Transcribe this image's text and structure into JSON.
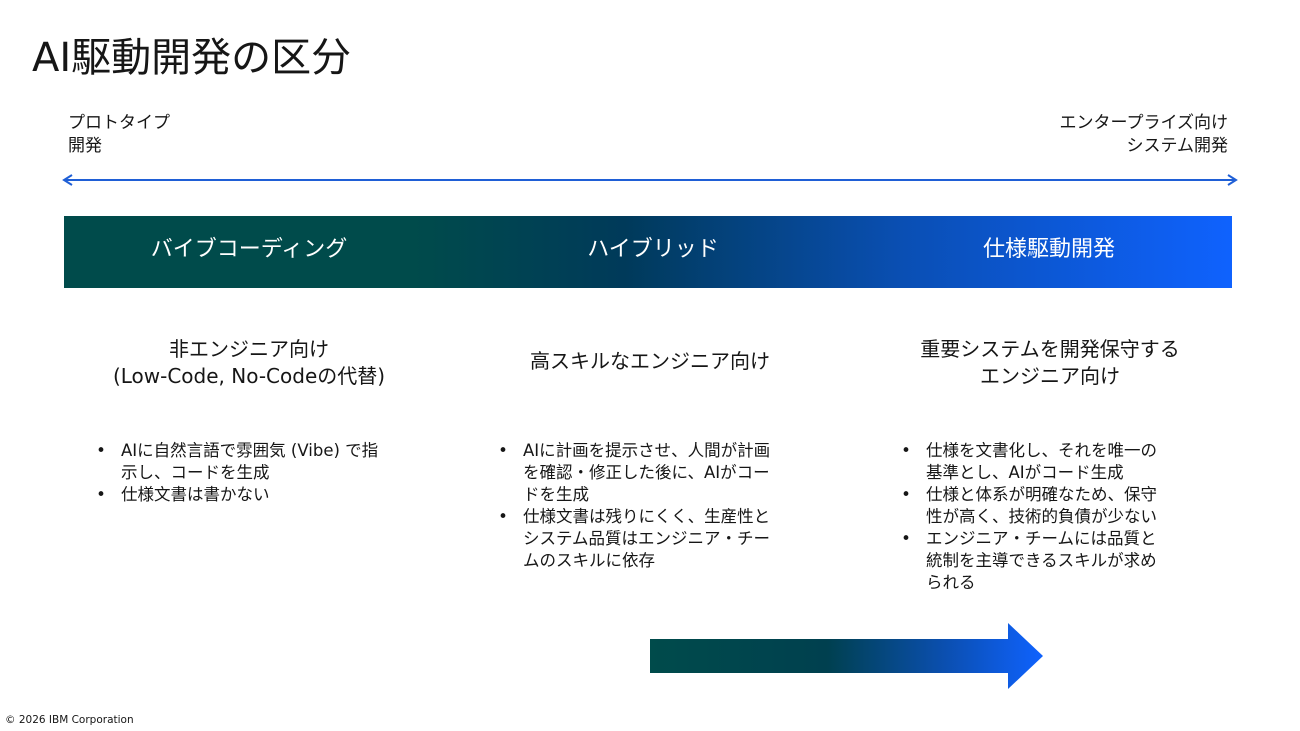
{
  "slide": {
    "title": "AI駆動開発の区分"
  },
  "spectrum": {
    "left_line1": "プロトタイプ",
    "left_line2": "開発",
    "right_line1": "エンタープライズ向け",
    "right_line2": "システム開発",
    "arrow_color": "#1f5fd6"
  },
  "columns": [
    {
      "label": "バイブコーディング",
      "audience": [
        "非エンジニア向け",
        "(Low-Code, No-Codeの代替)"
      ],
      "bullets": [
        [
          "AIに自然言語で雰囲気 (Vibe) で指",
          "示し、コードを生成"
        ],
        [
          "仕様文書は書かない"
        ]
      ]
    },
    {
      "label": "ハイブリッド",
      "audience": [
        "高スキルなエンジニア向け"
      ],
      "bullets": [
        [
          "AIに計画を提示させ、人間が計画",
          "を確認・修正した後に、AIがコー",
          "ドを生成"
        ],
        [
          "仕様文書は残りにくく、生産性と",
          "システム品質はエンジニア・チー",
          "ムのスキルに依存"
        ]
      ]
    },
    {
      "label": "仕様駆動開発",
      "audience": [
        "重要システムを開発保守する",
        "エンジニア向け"
      ],
      "bullets": [
        [
          "仕様を文書化し、それを唯一の",
          "基準とし、AIがコード生成"
        ],
        [
          "仕様と体系が明確なため、保守",
          "性が高く、技術的負債が少ない"
        ],
        [
          "エンジニア・チームには品質と",
          "統制を主導できるスキルが求め",
          "られる"
        ]
      ]
    }
  ],
  "colors": {
    "band_start": "#004B4B",
    "band_end": "#0F62FE"
  },
  "footer": {
    "copyright": "© 2026 IBM Corporation"
  }
}
